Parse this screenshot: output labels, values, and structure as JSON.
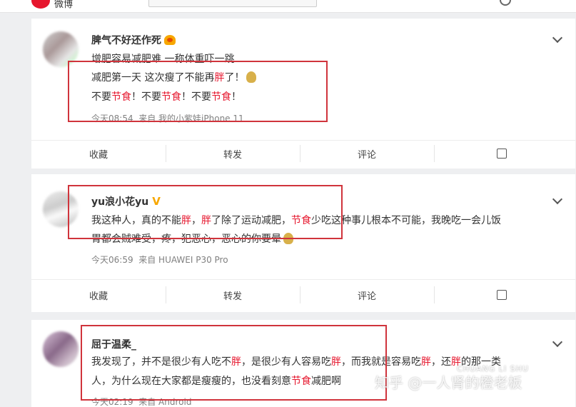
{
  "header": {
    "site_name": "微博"
  },
  "posts": [
    {
      "nickname": "脾气不好还作死",
      "badge": "crown-icon",
      "lines": [
        [
          "增肥容易减肥难 一称体重吓一跳"
        ],
        [
          "减肥第一天 这次瘦了不能再",
          "胖",
          "了！"
        ],
        [
          "不要",
          "节食",
          "！不要",
          "节食",
          "！不要",
          "节食",
          "！"
        ]
      ],
      "time": "今天08:54",
      "source": "来自 我的小紫娃iPhone 11"
    },
    {
      "nickname": "yu浪小花yu",
      "badge": "verified-v-icon",
      "lines": [
        [
          "我这种人，真的不能",
          "胖",
          "，",
          "胖",
          "了除了运动减肥，",
          "节食",
          "少吃这种事儿根本不可能，我晚吃一会儿饭"
        ],
        [
          "胃都会贼难受，疼，犯恶心，恶心的你要晕"
        ]
      ],
      "time": "今天06:59",
      "source": "来自 HUAWEI P30 Pro"
    },
    {
      "nickname": "屈于温柔_",
      "lines": [
        [
          "我发现了，并不是很少有人吃不",
          "胖",
          "，是很少有人容易吃",
          "胖",
          "，而我就是容易吃",
          "胖",
          "，还",
          "胖",
          "的那一类"
        ],
        [
          "人，为什么现在大家都是瘦瘦的，也没看刻意",
          "节食",
          "减肥啊"
        ]
      ],
      "time": "今天02:19",
      "source": "来自 Android"
    }
  ],
  "actions": {
    "favorite": "收藏",
    "repost": "转发",
    "comment": "评论"
  },
  "watermark": {
    "text": "知乎 @一人肾的橙老板",
    "en": "CHUANG LI SHU"
  },
  "colors": {
    "accent": "#e6162d",
    "highlight_box": "#d0343c"
  }
}
